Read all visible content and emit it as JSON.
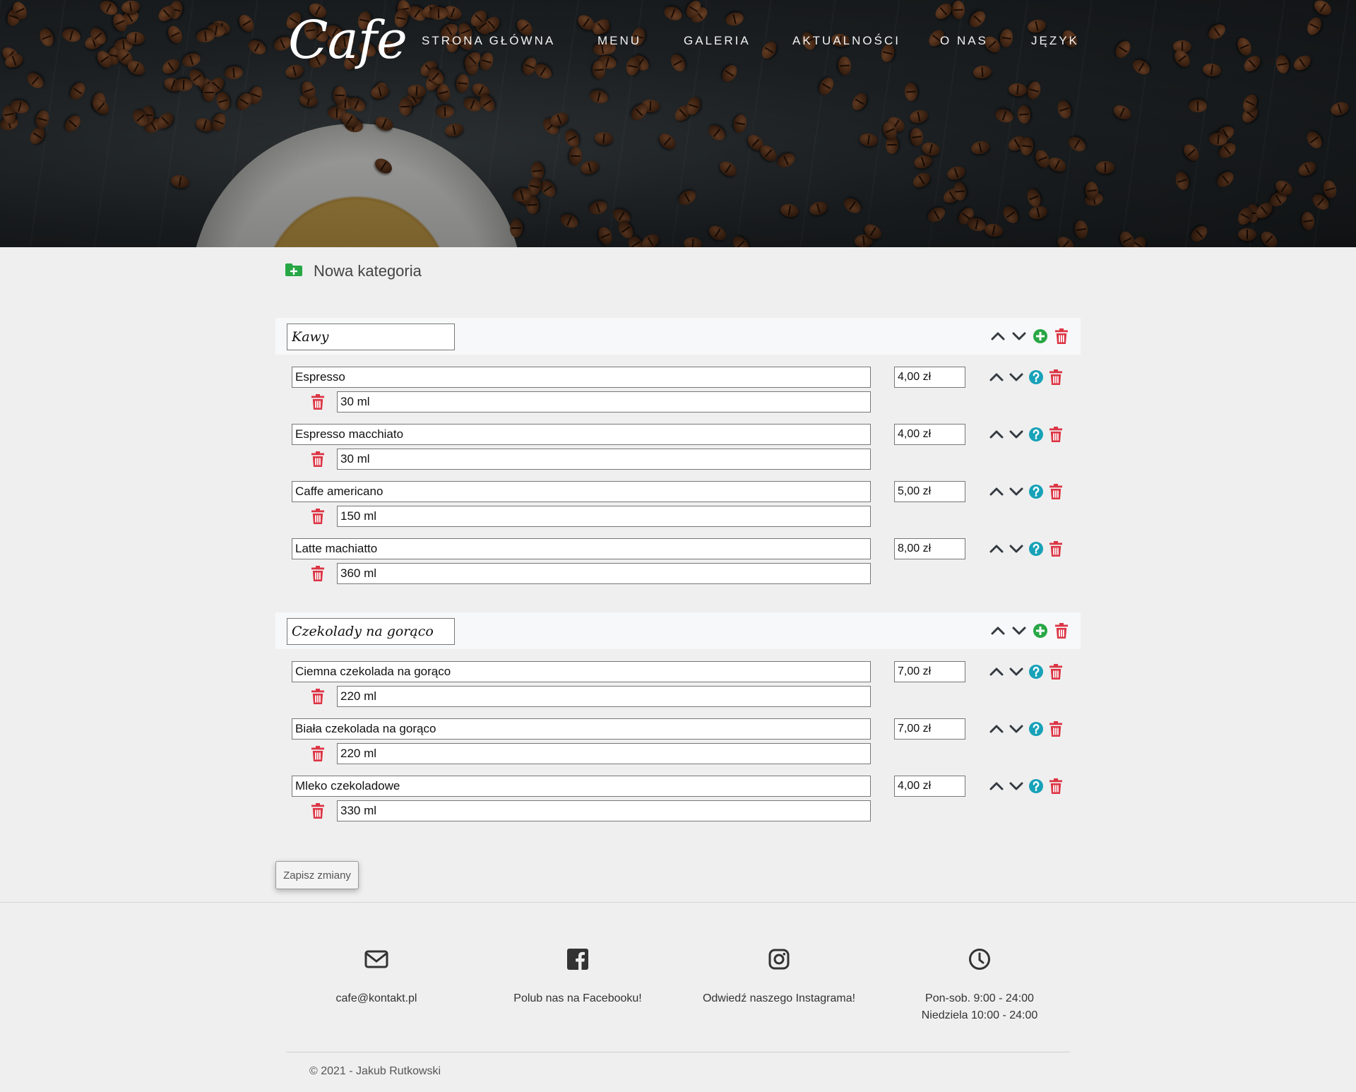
{
  "header": {
    "logo": "Cafe",
    "nav": [
      "STRONA GŁÓWNA",
      "MENU",
      "GALERIA",
      "AKTUALNOŚCI",
      "O NAS",
      "JĘZYK"
    ]
  },
  "new_category_label": "Nowa kategoria",
  "categories": [
    {
      "name": "Kawy",
      "items": [
        {
          "name": "Espresso",
          "price": "4,00 zł",
          "description": "30 ml"
        },
        {
          "name": "Espresso macchiato",
          "price": "4,00 zł",
          "description": "30 ml"
        },
        {
          "name": "Caffe americano",
          "price": "5,00 zł",
          "description": "150 ml"
        },
        {
          "name": "Latte machiatto",
          "price": "8,00 zł",
          "description": "360 ml"
        }
      ]
    },
    {
      "name": "Czekolady na gorąco",
      "items": [
        {
          "name": "Ciemna czekolada na gorąco",
          "price": "7,00 zł",
          "description": "220 ml"
        },
        {
          "name": "Biała czekolada na gorąco",
          "price": "7,00 zł",
          "description": "220 ml"
        },
        {
          "name": "Mleko czekoladowe",
          "price": "4,00 zł",
          "description": "330 ml"
        }
      ]
    }
  ],
  "save_button": "Zapisz zmiany",
  "footer": {
    "email": "cafe@kontakt.pl",
    "facebook": "Polub nas na Facebooku!",
    "instagram": "Odwiedź naszego Instagrama!",
    "hours_weekdays": "Pon-sob. 9:00 - 24:00",
    "hours_sunday": "Niedziela 10:00 - 24:00",
    "copyright": "© 2021 - Jakub Rutkowski"
  },
  "colors": {
    "danger": "#dc3545",
    "success": "#28a745",
    "info": "#17a2b8",
    "dark": "#343a40"
  },
  "icons": [
    "folder-plus-icon",
    "chevron-up-icon",
    "chevron-down-icon",
    "plus-circle-icon",
    "question-circle-icon",
    "trash-icon",
    "envelope-icon",
    "facebook-icon",
    "instagram-icon",
    "clock-icon"
  ]
}
